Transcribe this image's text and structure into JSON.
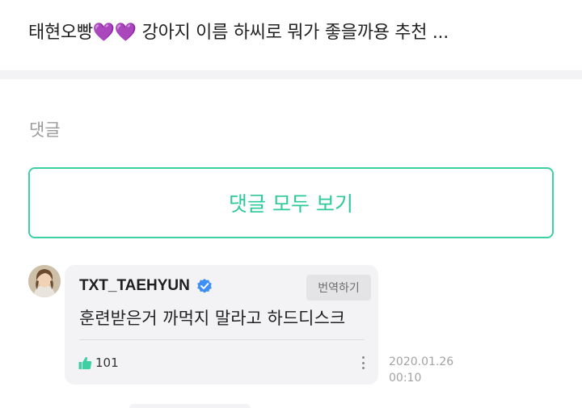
{
  "post": {
    "text": "태현오빵💜💜 강아지 이름 하씨로 뭐가 좋을까용 추천 ..."
  },
  "comments_section": {
    "title": "댓글",
    "view_all_label": "댓글 모두 보기"
  },
  "comment": {
    "author": "TXT_TAEHYUN",
    "verified": true,
    "translate_label": "번역하기",
    "text": "훈련받은거 까먹지 말라고 하드디스크",
    "likes": "101",
    "date": "2020.01.26",
    "time": "00:10"
  },
  "colors": {
    "accent": "#2ec99b",
    "verified_badge": "#3d8ef7",
    "like_icon": "#3ecfa3"
  }
}
